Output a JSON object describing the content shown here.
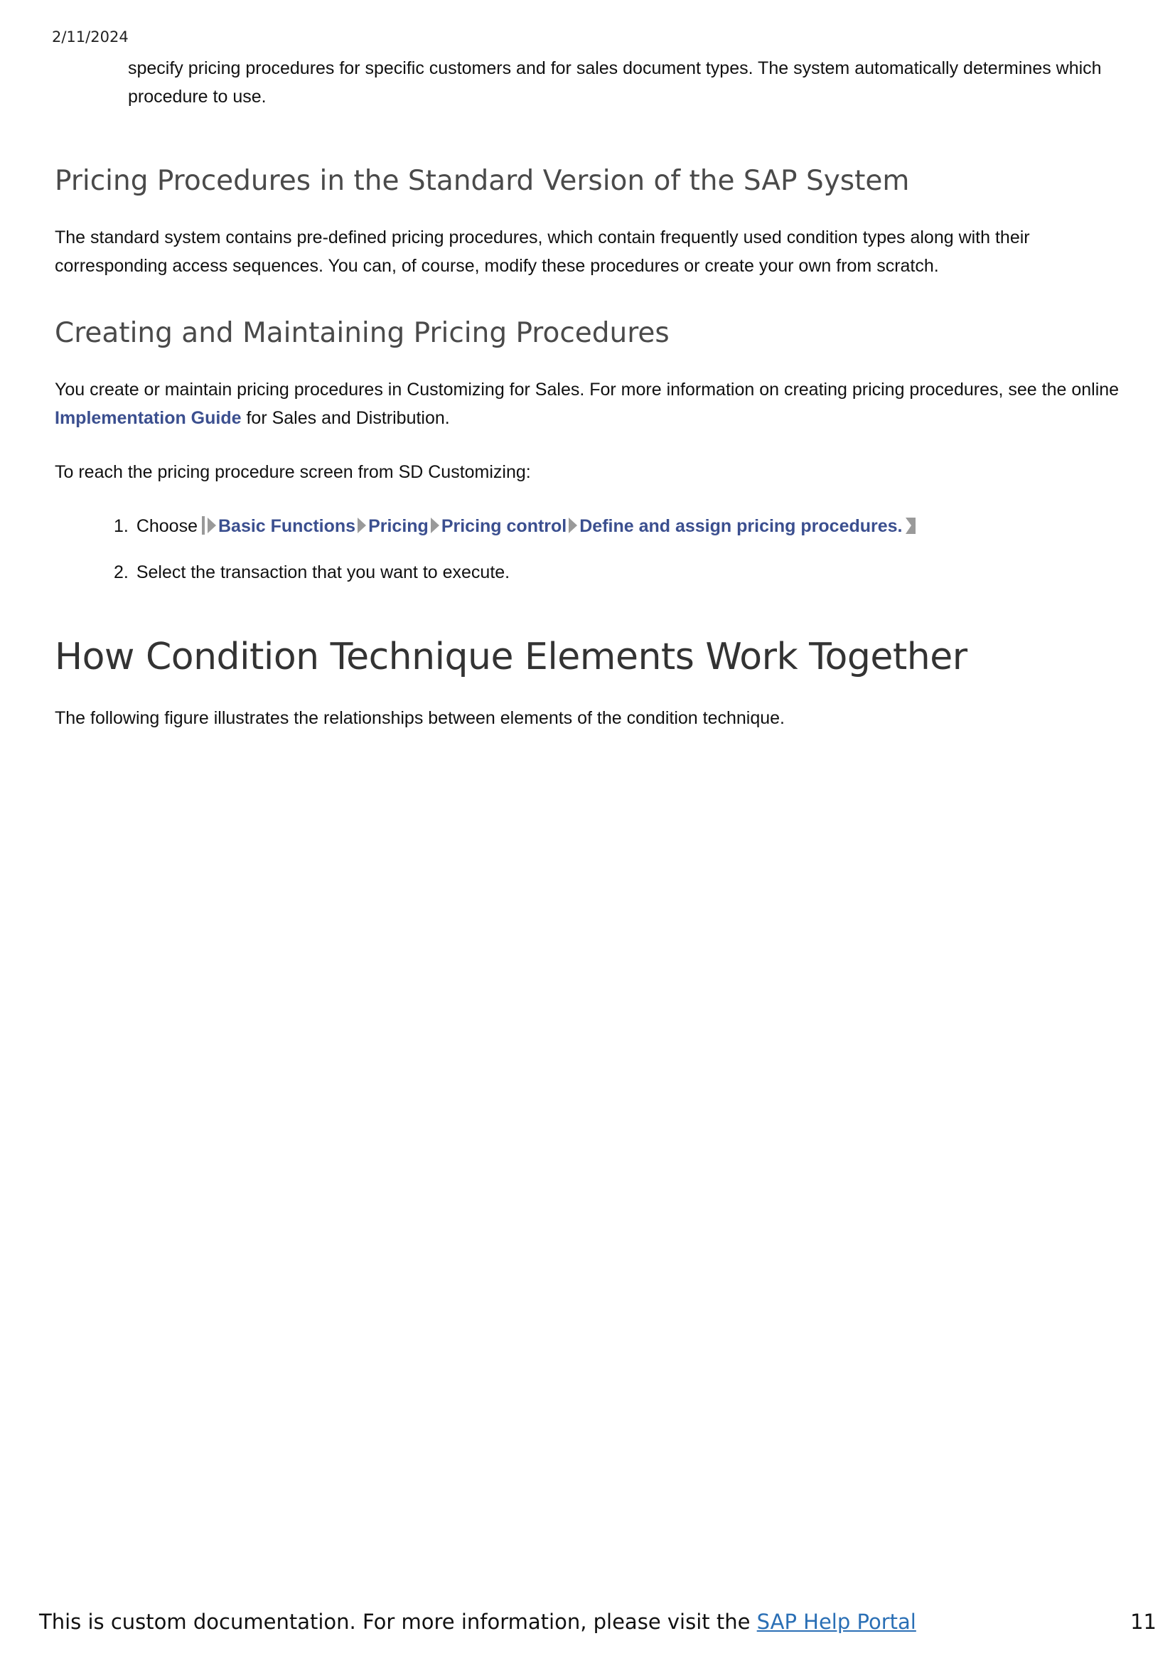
{
  "header": {
    "date": "2/11/2024"
  },
  "continued_paragraph": "specify pricing procedures for specific customers and for sales document types. The system automatically determines which procedure to use.",
  "section_standard": {
    "heading": "Pricing Procedures in the Standard Version of the SAP System",
    "body": "The standard system contains pre-defined pricing procedures, which contain frequently used condition types along with their corresponding access sequences. You can, of course, modify these procedures or create your own from scratch."
  },
  "section_creating": {
    "heading": "Creating and Maintaining Pricing Procedures",
    "body_before_link": "You create or maintain pricing procedures in Customizing for Sales. For more information on creating pricing procedures, see the online ",
    "link": "Implementation Guide",
    "body_after_link": " for Sales and Distribution.",
    "reach_text": "To reach the pricing procedure screen from SD Customizing:",
    "steps": [
      {
        "number": "1.",
        "prefix": "Choose",
        "menu_path": [
          "Basic Functions",
          "Pricing",
          "Pricing control",
          "Define and assign pricing procedures."
        ]
      },
      {
        "number": "2.",
        "text": "Select the transaction that you want to execute."
      }
    ]
  },
  "section_how": {
    "heading": "How Condition Technique Elements Work Together",
    "body": "The following figure illustrates the relationships between elements of the condition technique."
  },
  "footer": {
    "text": "This is custom documentation. For more information, please visit the ",
    "link": "SAP Help Portal",
    "page_number": "11"
  }
}
